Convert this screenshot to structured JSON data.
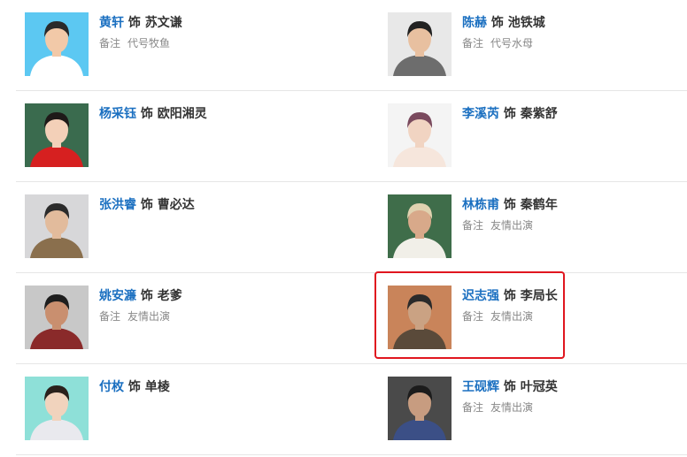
{
  "cast": [
    [
      {
        "actor": "黄轩",
        "role": "苏文谦",
        "note": "代号牧鱼",
        "bg": "#5cc8f2",
        "skin": "#f2c9a8",
        "hair": "#2a2a2a",
        "cloth": "#ffffff"
      },
      {
        "actor": "陈赫",
        "role": "池铁城",
        "note": "代号水母",
        "bg": "#e8e8e8",
        "skin": "#e8c0a0",
        "hair": "#222222",
        "cloth": "#6d6d6d"
      }
    ],
    [
      {
        "actor": "杨采钰",
        "role": "欧阳湘灵",
        "note": "",
        "bg": "#3a6b4e",
        "skin": "#f3d0b8",
        "hair": "#1e1a18",
        "cloth": "#d62020"
      },
      {
        "actor": "李溪芮",
        "role": "秦紫舒",
        "note": "",
        "bg": "#f4f4f4",
        "skin": "#f1d4c2",
        "hair": "#7a4a5e",
        "cloth": "#f6e6dc"
      }
    ],
    [
      {
        "actor": "张洪睿",
        "role": "曹必达",
        "note": "",
        "bg": "#d7d7d9",
        "skin": "#e2bb9c",
        "hair": "#2b2b2b",
        "cloth": "#8a6f4d"
      },
      {
        "actor": "林栋甫",
        "role": "秦鹤年",
        "note": "友情出演",
        "bg": "#3f6d4a",
        "skin": "#d8a98a",
        "hair": "#e0d2b0",
        "cloth": "#f1efe8"
      }
    ],
    [
      {
        "actor": "姚安濂",
        "role": "老爹",
        "note": "友情出演",
        "bg": "#c8c8c8",
        "skin": "#c98f6f",
        "hair": "#1e1e1e",
        "cloth": "#8a2a2a"
      },
      {
        "actor": "迟志强",
        "role": "李局长",
        "note": "友情出演",
        "bg": "#c9845a",
        "skin": "#caa283",
        "hair": "#2a2a2a",
        "cloth": "#5a4a3a"
      }
    ],
    [
      {
        "actor": "付枚",
        "role": "单棱",
        "note": "",
        "bg": "#8ee0d8",
        "skin": "#f1d3bd",
        "hair": "#2a211c",
        "cloth": "#e9e9ee"
      },
      {
        "actor": "王砚辉",
        "role": "叶冠英",
        "note": "友情出演",
        "bg": "#4a4a4a",
        "skin": "#c79c80",
        "hair": "#1c1c1c",
        "cloth": "#3b4f86"
      }
    ]
  ],
  "labels": {
    "shi": "饰",
    "beizhu": "备注"
  },
  "highlight_color": "#e0161f"
}
